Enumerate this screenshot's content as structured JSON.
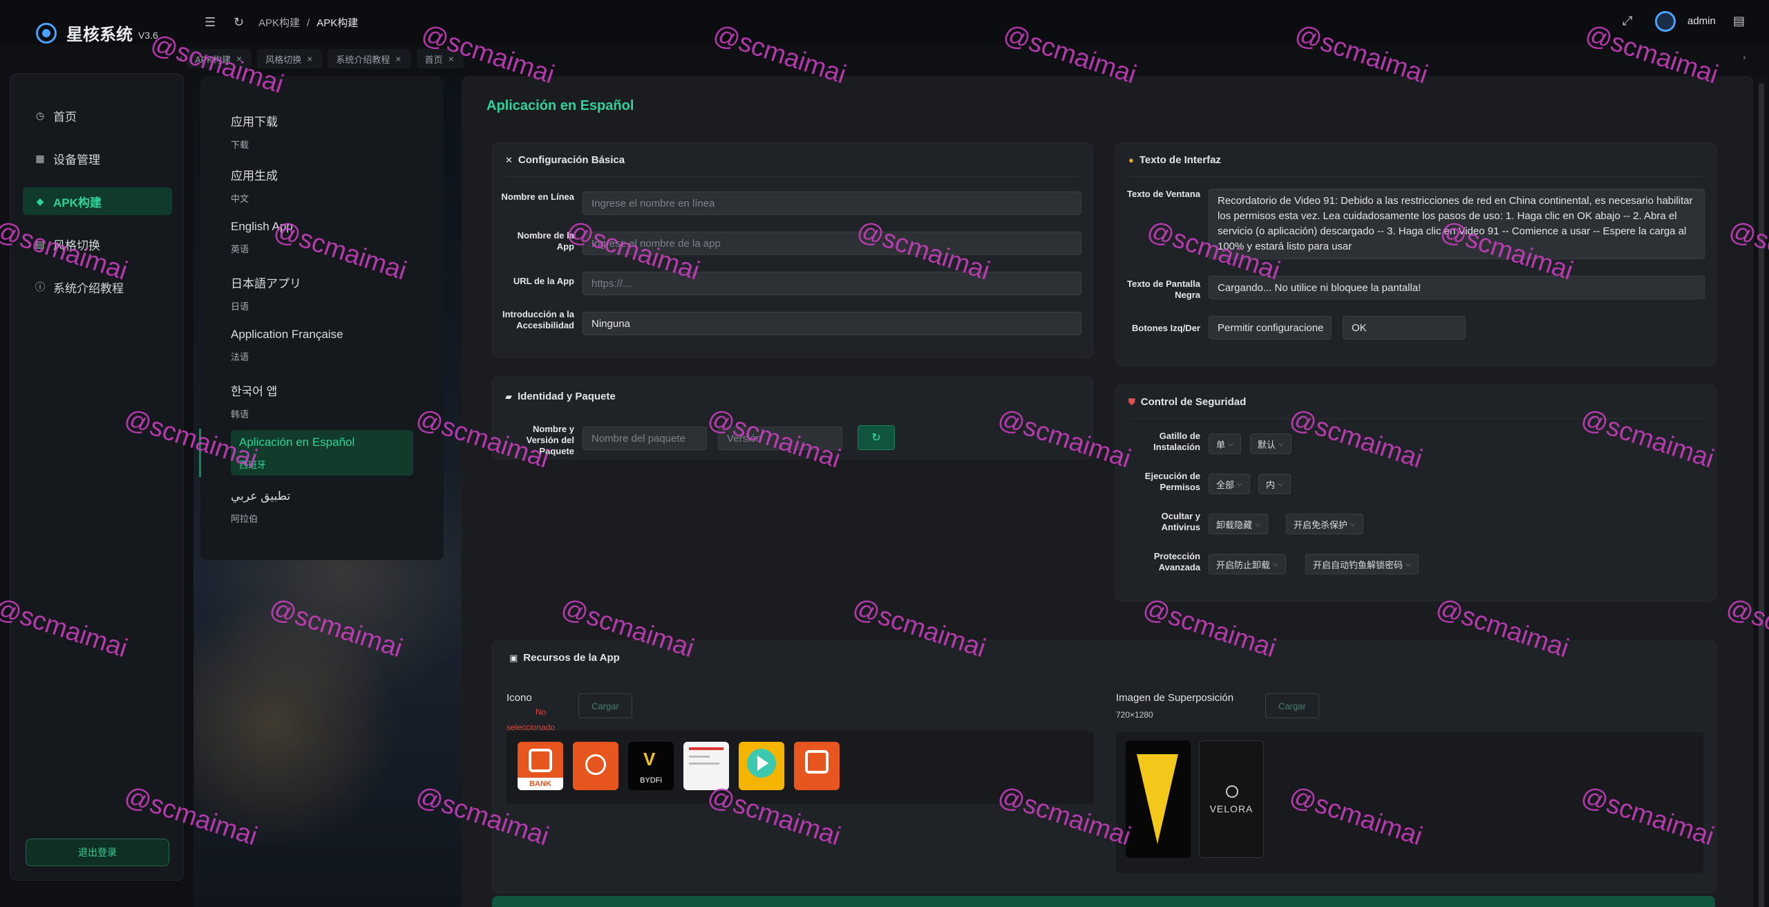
{
  "app": {
    "name": "星核系统",
    "version": "V3.6"
  },
  "header": {
    "breadcrumb": [
      "APK构建",
      "APK构建"
    ],
    "username": "admin"
  },
  "tabs": [
    {
      "label": "APK构建"
    },
    {
      "label": "风格切换"
    },
    {
      "label": "系统介绍教程"
    },
    {
      "label": "首页"
    }
  ],
  "sidebar": {
    "items": [
      {
        "label": "首页",
        "icon": "clock-icon"
      },
      {
        "label": "设备管理",
        "icon": "grid-icon"
      },
      {
        "label": "APK构建",
        "icon": "box-icon"
      },
      {
        "label": "风格切换",
        "icon": "document-icon"
      },
      {
        "label": "系统介绍教程",
        "icon": "info-icon"
      }
    ],
    "logout": "退出登录"
  },
  "languages": [
    {
      "title": "应用下载",
      "sub": "下载"
    },
    {
      "title": "应用生成",
      "sub": "中文"
    },
    {
      "title": "English App",
      "sub": "英语"
    },
    {
      "title": "日本語アプリ",
      "sub": "日语"
    },
    {
      "title": "Application Française",
      "sub": "法语"
    },
    {
      "title": "한국어 앱",
      "sub": "韩语"
    },
    {
      "title": "Aplicación en Español",
      "sub": "西班牙"
    },
    {
      "title": "تطبيق عربي",
      "sub": "阿拉伯"
    }
  ],
  "main": {
    "title": "Aplicación en Español",
    "basic": {
      "title": "Configuración Básica",
      "online_name_label": "Nombre en Línea",
      "online_name_placeholder": "Ingrese el nombre en línea",
      "app_name_label": "Nombre de la App",
      "app_name_placeholder": "Ingrese el nombre de la app",
      "url_label": "URL de la App",
      "url_placeholder": "https://...",
      "access_label": "Introducción a la Accesibilidad",
      "access_value": "Ninguna"
    },
    "identity": {
      "title": "Identidad y Paquete",
      "label": "Nombre y Versión del Paquete",
      "package_placeholder": "Nombre del paquete",
      "version_placeholder": "Versión"
    },
    "interface": {
      "title": "Texto de Interfaz",
      "window_label": "Texto de Ventana",
      "window_text": "Recordatorio de Video 91: Debido a las restricciones de red en China continental, es necesario habilitar los permisos esta vez. Lea cuidadosamente los pasos de uso: 1. Haga clic en OK abajo -- 2. Abra el servicio (o aplicación) descargado -- 3. Haga clic en Video 91 -- Comience a usar -- Espere la carga al 100% y estará listo para usar",
      "black_label": "Texto de Pantalla Negra",
      "black_text": "Cargando... No utilice ni bloquee la pantalla!",
      "buttons_label": "Botones Izq/Der",
      "left_button": "Permitir configuracione",
      "right_button": "OK"
    },
    "security": {
      "title": "Control de Seguridad",
      "rows": [
        {
          "label": "Gatillo de Instalación",
          "a": "单",
          "b": "默认"
        },
        {
          "label": "Ejecución de Permisos",
          "a": "全部",
          "b": "内"
        },
        {
          "label": "Ocultar y Antivirus",
          "a": "卸载隐藏",
          "b": "开启免杀保护"
        },
        {
          "label": "Protección Avanzada",
          "a": "开启防止卸载",
          "b": "开启自动钓鱼解锁密码"
        }
      ]
    },
    "resources": {
      "title": "Recursos de la App",
      "icon_label": "Icono",
      "icon_status": "No seleccionado",
      "upload": "Cargar",
      "overlay_label": "Imagen de Superposición",
      "overlay_size": "720×1280",
      "thumb_texts": [
        "BANK",
        "",
        "BYDFi",
        "",
        "",
        ""
      ],
      "overlay_texts": [
        "",
        "VELORA"
      ]
    }
  },
  "watermark": "@scmaimai",
  "colors": {
    "accent": "#2fd39a",
    "watermark": "#d040c4",
    "error": "#e0443a"
  }
}
